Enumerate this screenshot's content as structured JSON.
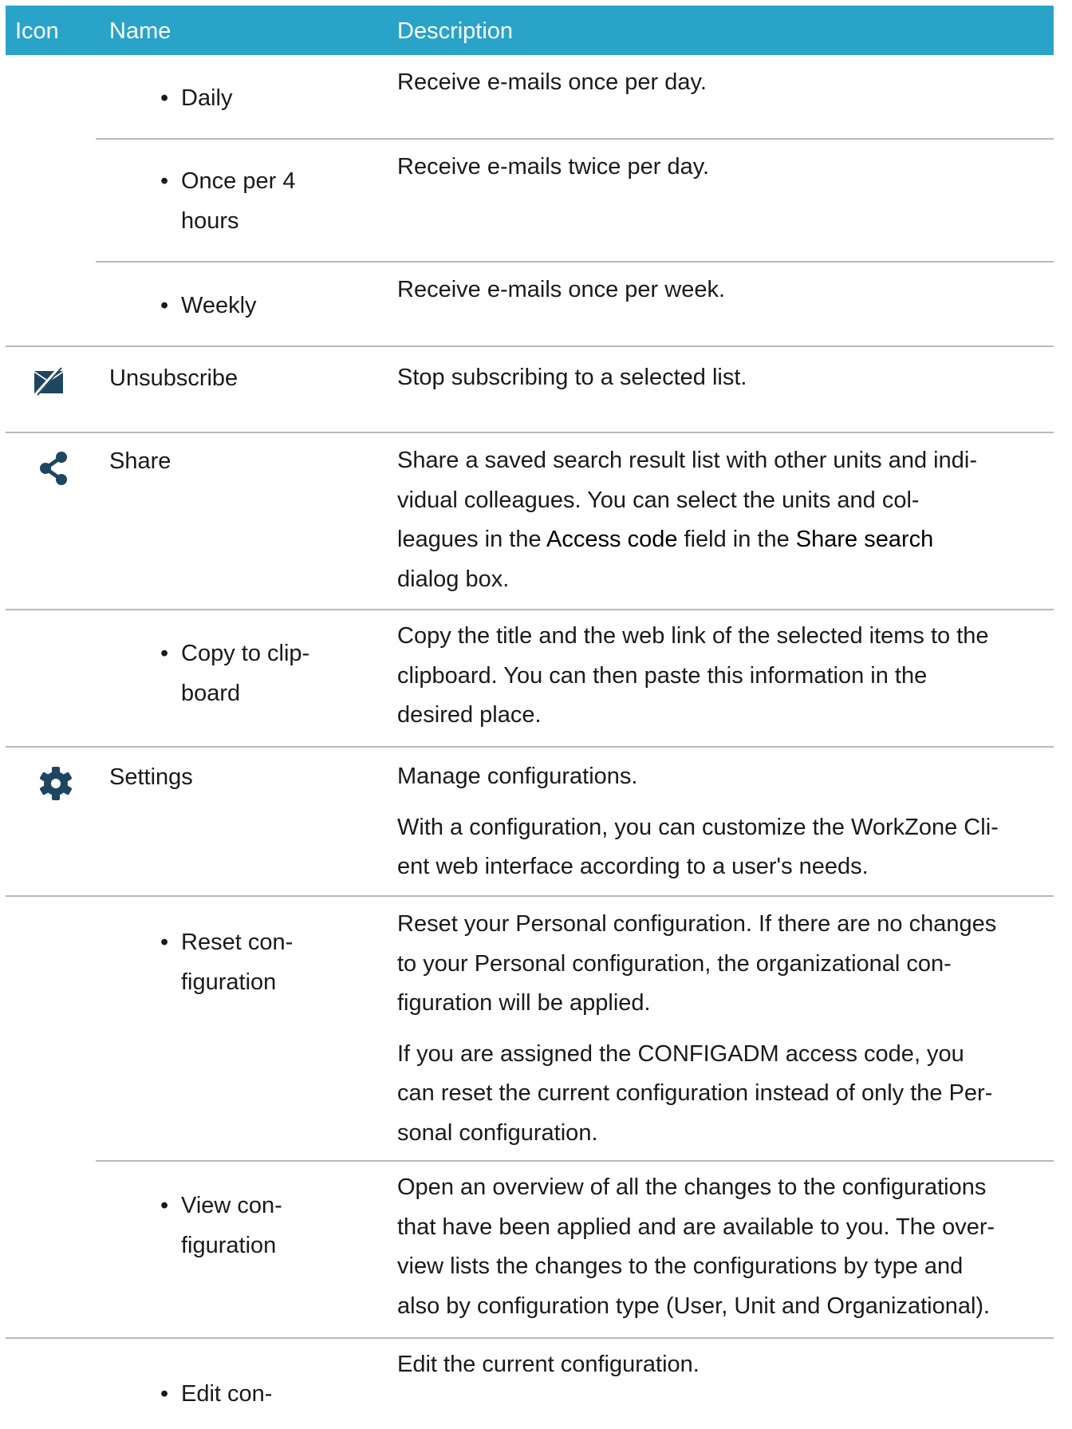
{
  "header": {
    "icon": "Icon",
    "name": "Name",
    "description": "Description"
  },
  "rows": [
    {
      "name": "Daily",
      "desc1": "Receive e-mails once per day."
    },
    {
      "name_l1": "Once per 4",
      "name_l2": "hours",
      "desc1": "Receive e-mails twice per day."
    },
    {
      "name": "Weekly",
      "desc1": "Receive e-mails once per week."
    },
    {
      "icon": "unsubscribe-mail-icon",
      "name": "Unsubscribe",
      "desc1": "Stop subscribing to a selected list."
    },
    {
      "icon": "share-icon",
      "name": "Share",
      "desc_l1": "Share a saved search result list with other units and indi-",
      "desc_l2": "vidual colleagues. You can select the units and col-",
      "desc_l3a": "leagues in the ",
      "desc_l3b": "Access code",
      "desc_l3c": " field in the ",
      "desc_l3d": "Share search",
      "desc_l4": "dialog box."
    },
    {
      "name_l1": "Copy to clip-",
      "name_l2": "board",
      "desc_l1": "Copy the title and the web link of the selected items to the",
      "desc_l2": "clipboard. You can then paste this information in the",
      "desc_l3": "desired place."
    },
    {
      "icon": "gear-icon",
      "name": "Settings",
      "desc1": "Manage configurations.",
      "desc2_l1": "With a configuration, you can customize the WorkZone Cli-",
      "desc2_l2": "ent web interface according to a user's needs."
    },
    {
      "name_l1": "Reset con-",
      "name_l2": "figuration",
      "desc1_l1": "Reset your Personal configuration. If there are no changes",
      "desc1_l2": "to your Personal configuration, the organizational con-",
      "desc1_l3": "figuration will be applied.",
      "desc2_l1": "If you are assigned the CONFIGADM access code, you",
      "desc2_l2": "can reset the current configuration instead of only the Per-",
      "desc2_l3": "sonal configuration."
    },
    {
      "name_l1": "View con-",
      "name_l2": "figuration",
      "desc_l1": "Open an overview of all the changes to the configurations",
      "desc_l2": "that have been applied and are available to you. The over-",
      "desc_l3": "view lists the changes to the configurations by type and",
      "desc_l4": "also by configuration type (User, Unit and Organizational)."
    },
    {
      "name_l1": "Edit con-",
      "desc1": "Edit the current configuration."
    }
  ],
  "colors": {
    "header_bg": "#2aa3c9",
    "rule": "#b9b9b9",
    "icon": "#1e4660"
  }
}
